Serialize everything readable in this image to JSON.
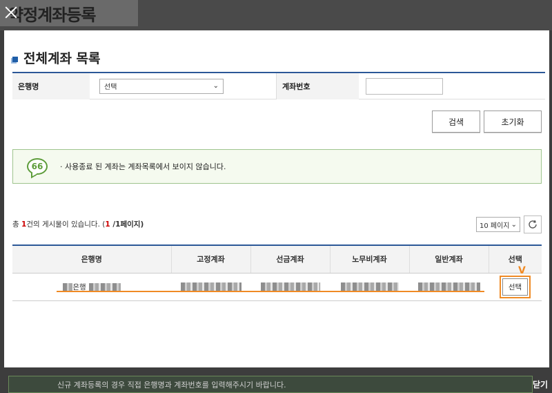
{
  "background": {
    "page_title": "약정계좌등록",
    "bottom_notice": "신규 계좌등록의 경우 직접 은행명과 계좌번호를 입력해주시기 바랍니다.",
    "close_label": "닫기"
  },
  "modal": {
    "section_title": "전체계좌 목록",
    "search": {
      "bank_label": "은행명",
      "bank_select_value": "선택",
      "account_label": "계좌번호",
      "account_value": ""
    },
    "buttons": {
      "search": "검색",
      "reset": "초기화"
    },
    "notice": {
      "icon_text": "66",
      "text": "·  사용종료 된 계좌는 계좌목록에서 보이지 않습니다."
    },
    "list_info": {
      "prefix": "총 ",
      "count": "1",
      "middle": "건의 게시물이 있습니다. (",
      "page_current": "1",
      "page_rest": " /1페이지)"
    },
    "per_page": "10 페이지",
    "table": {
      "headers": [
        "은행명",
        "고정계좌",
        "선금계좌",
        "노무비계좌",
        "일반계좌",
        "선택"
      ],
      "rows": [
        {
          "bank": "은행",
          "select": "선택"
        }
      ]
    },
    "annotation_mark": "V"
  },
  "colors": {
    "accent_blue": "#2b5797",
    "notice_green": "#5d9c3a",
    "highlight_orange": "#f08a24"
  }
}
